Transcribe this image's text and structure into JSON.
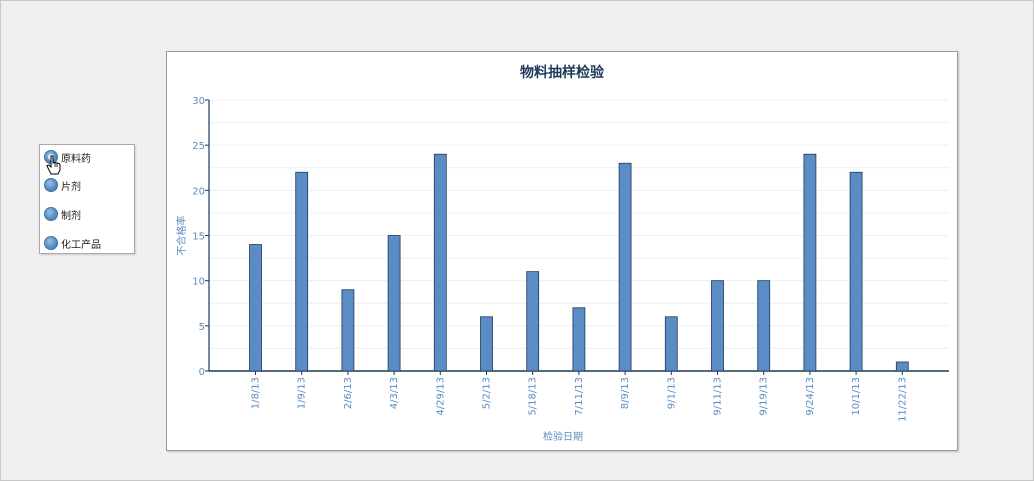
{
  "selector": {
    "options": [
      {
        "label": "原料药",
        "selected": true
      },
      {
        "label": "片剂",
        "selected": false
      },
      {
        "label": "制剂",
        "selected": false
      },
      {
        "label": "化工产品",
        "selected": false
      }
    ]
  },
  "chart_data": {
    "type": "bar",
    "title": "物料抽样检验",
    "xlabel": "检验日期",
    "ylabel": "不合格率",
    "categories": [
      "1/8/13",
      "1/9/13",
      "2/6/13",
      "4/3/13",
      "4/29/13",
      "5/2/13",
      "5/18/13",
      "7/11/13",
      "8/9/13",
      "9/1/13",
      "9/11/13",
      "9/19/13",
      "9/24/13",
      "10/1/13",
      "11/22/13"
    ],
    "values": [
      14,
      22,
      9,
      15,
      24,
      6,
      11,
      7,
      23,
      6,
      10,
      10,
      24,
      22,
      1
    ],
    "ylim": [
      0,
      30
    ],
    "yticks": [
      0,
      5,
      10,
      15,
      20,
      25,
      30
    ],
    "grid": true,
    "bar_color": "#5b8cc6",
    "bar_edge_color": "#1f3a5a",
    "axis_text_color": "#5b8cc0",
    "legend": "none"
  }
}
